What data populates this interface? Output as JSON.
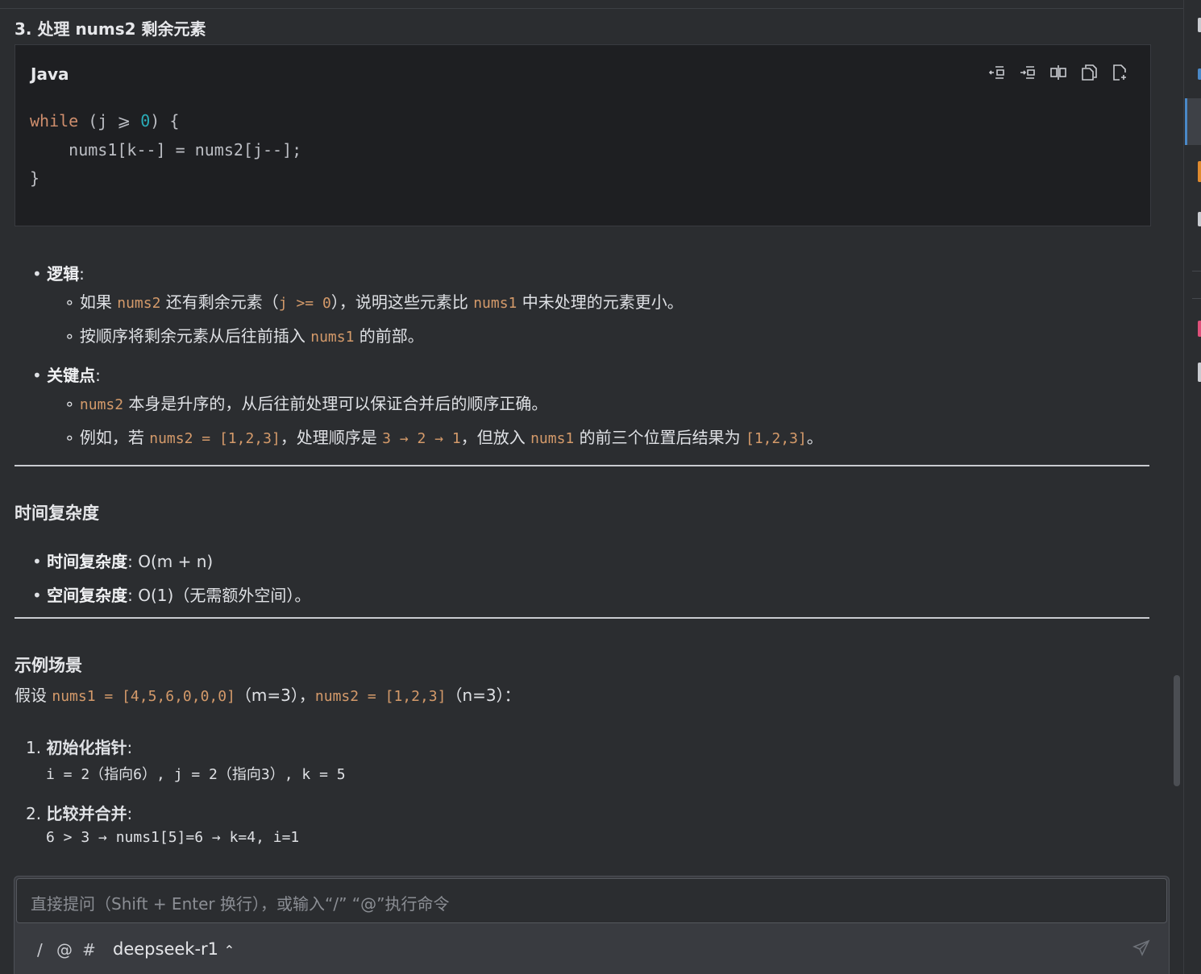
{
  "section_heading": "3. 处理 nums2 剩余元素",
  "code_block": {
    "language": "Java",
    "toolbar_icons": [
      "insert-left-icon",
      "insert-right-icon",
      "diff-icon",
      "copy-icon",
      "new-file-icon"
    ],
    "lines": {
      "l1_kw": "while",
      "l1_a": " (j ",
      "l1_op": "⩾",
      "l1_b": " ",
      "l1_num": "0",
      "l1_c": ") {",
      "l2": "    nums1[k--] = nums2[j--];",
      "l3": "}"
    }
  },
  "logic": {
    "label": "逻辑",
    "colon": ":",
    "item1": {
      "a": "如果 ",
      "code1": "nums2",
      "b": " 还有剩余元素（",
      "code2": "j >= 0",
      "c": "），说明这些元素比 ",
      "code3": "nums1",
      "d": " 中未处理的元素更小。"
    },
    "item2": {
      "a": "按顺序将剩余元素从后往前插入 ",
      "code1": "nums1",
      "b": " 的前部。"
    }
  },
  "keypoints": {
    "label": "关键点",
    "colon": ":",
    "item1": {
      "code1": "nums2",
      "a": " 本身是升序的，从后往前处理可以保证合并后的顺序正确。"
    },
    "item2": {
      "a": "例如，若 ",
      "code1": "nums2 = [1,2,3]",
      "b": "，处理顺序是 ",
      "code2": "3 → 2 → 1",
      "c": "，但放入 ",
      "code3": "nums1",
      "d": " 的前三个位置后结果为 ",
      "code4": "[1,2,3]",
      "e": "。"
    }
  },
  "complexity": {
    "heading": "时间复杂度",
    "time_label": "时间复杂度",
    "time_value": ": O(m + n)",
    "space_label": "空间复杂度",
    "space_value": ": O(1)（无需额外空间）。"
  },
  "example": {
    "heading": "示例场景",
    "intro": {
      "a": "假设 ",
      "code1": "nums1 = [4,5,6,0,0,0]",
      "b": "（m=3），",
      "code2": "nums2 = [1,2,3]",
      "c": "（n=3）："
    },
    "step1": {
      "num": "1.",
      "label": "初始化指针",
      "colon": ":",
      "code": "i = 2（指向6）, j = 2（指向3）, k = 5"
    },
    "step2": {
      "num": "2.",
      "label": "比较并合并",
      "colon": ":",
      "code": "6 > 3 → nums1[5]=6 → k=4, i=1"
    }
  },
  "composer": {
    "placeholder": "直接提问（Shift + Enter 换行），或输入“/” “@”执行命令",
    "slash": "/",
    "at": "@",
    "hash": "#",
    "model": "deepseek-r1",
    "model_chevron": "⌃"
  },
  "colors": {
    "background": "#2b2d30",
    "code_background": "#1e1f22",
    "inline_code": "#d49a6a",
    "keyword": "#cf8e6d",
    "number": "#2aacb8"
  }
}
